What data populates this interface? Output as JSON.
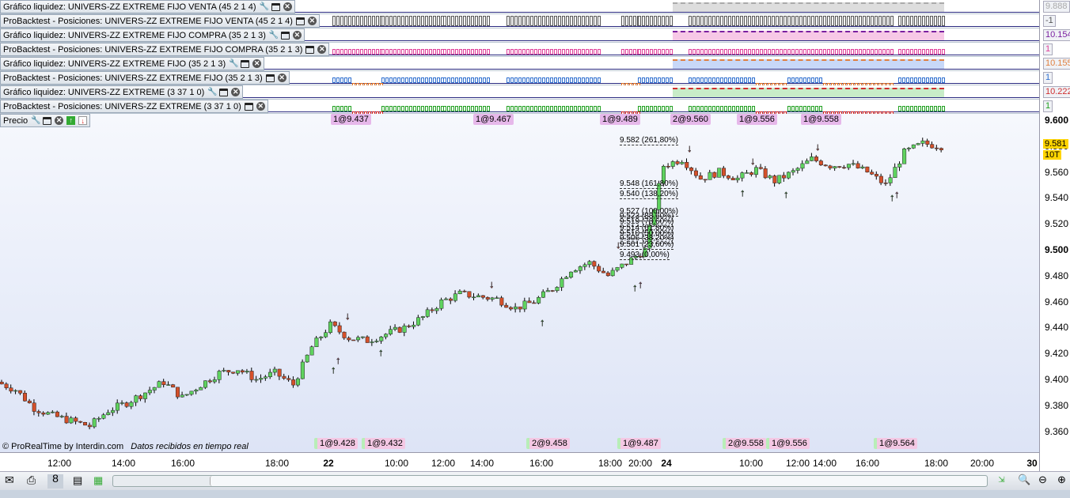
{
  "strips": [
    {
      "title": "Gráfico liquidez: UNIVERS-ZZ EXTREME FIJO VENTA (45 2 1 4)",
      "wrench": true,
      "value": "9.888",
      "color": "#aaaaaa",
      "kind": "equity"
    },
    {
      "title": "ProBacktest - Posiciones: UNIVERS-ZZ EXTREME FIJO VENTA (45 2 1 4)",
      "wrench": false,
      "value": "-1",
      "color": "#555555",
      "kind": "pos"
    },
    {
      "title": "Gráfico liquidez: UNIVERS-ZZ EXTREME FIJO COMPRA (35 2 1 3)",
      "wrench": true,
      "value": "10.154",
      "color": "#7a1fa0",
      "kind": "equity",
      "fill": "#f7c8e6"
    },
    {
      "title": "ProBacktest - Posiciones: UNIVERS-ZZ EXTREME FIJO COMPRA (35 2 1 3)",
      "wrench": false,
      "value": "1",
      "color": "#e0409a",
      "kind": "pos"
    },
    {
      "title": "Gráfico liquidez: UNIVERS-ZZ EXTREME FIJO (35 2 1 3)",
      "wrench": true,
      "value": "10.155",
      "color": "#e08040",
      "kind": "equity",
      "fill": "#c8d8f8"
    },
    {
      "title": "ProBacktest - Posiciones: UNIVERS-ZZ EXTREME FIJO (35 2 1 3)",
      "wrench": false,
      "value": "1",
      "color": "#3070d0",
      "kind": "pos",
      "neg": "#e07020"
    },
    {
      "title": "Gráfico liquidez: UNIVERS-ZZ EXTREME (3 37 1 0)",
      "wrench": true,
      "value": "10.222",
      "color": "#d03030",
      "kind": "equity",
      "fill": "#c8ecc8"
    },
    {
      "title": "ProBacktest - Posiciones: UNIVERS-ZZ EXTREME (3 37 1 0)",
      "wrench": false,
      "value": "1",
      "color": "#20a020",
      "kind": "pos",
      "neg": "#d02020"
    }
  ],
  "price_panel": {
    "title": "Precio",
    "last_price": "9.581",
    "last_volume": "10T",
    "credit": "© ProRealTime by Interdin.com",
    "status": "Datos recibidos en tiempo real"
  },
  "top_trades": [
    "1@9.437",
    "1@9.467",
    "1@9.489",
    "2@9.560",
    "1@9.556",
    "1@9.558"
  ],
  "bottom_trades": [
    "1@9.428",
    "1@9.432",
    "2@9.458",
    "1@9.487",
    "2@9.558",
    "1@9.556",
    "1@9.564"
  ],
  "fib_levels": [
    "9.582 (261,80%)",
    "9.548 (161,80%)",
    "9.540 (138,20%)",
    "9.527 (100,00%)",
    "9.523 (88,60%)",
    "9.519 (78,60%)",
    "9.514 (61,80%)",
    "9.510 (50,00%)",
    "9.506 (38,20%)",
    "9.501 (23,60%)",
    "9.493 (0,00%)"
  ],
  "x_axis": [
    "12:00",
    "14:00",
    "16:00",
    "18:00",
    "22",
    "10:00",
    "12:00",
    "14:00",
    "16:00",
    "18:00",
    "20:00",
    "24",
    "10:00",
    "12:00",
    "14:00",
    "16:00",
    "18:00",
    "20:00",
    "30"
  ],
  "chart_data": {
    "type": "candlestick",
    "ylim": [
      9.35,
      9.605
    ],
    "y_ticks": [
      "9.600",
      "9.580",
      "9.560",
      "9.540",
      "9.520",
      "9.500",
      "9.480",
      "9.460",
      "9.440",
      "9.420",
      "9.400",
      "9.380",
      "9.360"
    ],
    "closes": [
      9.398,
      9.392,
      9.378,
      9.372,
      9.368,
      9.364,
      9.376,
      9.382,
      9.39,
      9.398,
      9.386,
      9.396,
      9.405,
      9.408,
      9.4,
      9.405,
      9.396,
      9.425,
      9.442,
      9.432,
      9.43,
      9.435,
      9.44,
      9.448,
      9.46,
      9.466,
      9.464,
      9.462,
      9.455,
      9.46,
      9.47,
      9.485,
      9.49,
      9.48,
      9.49,
      9.5,
      9.565,
      9.57,
      9.555,
      9.56,
      9.555,
      9.562,
      9.553,
      9.56,
      9.57,
      9.565,
      9.566,
      9.56,
      9.55,
      9.575,
      9.582,
      9.58
    ]
  }
}
